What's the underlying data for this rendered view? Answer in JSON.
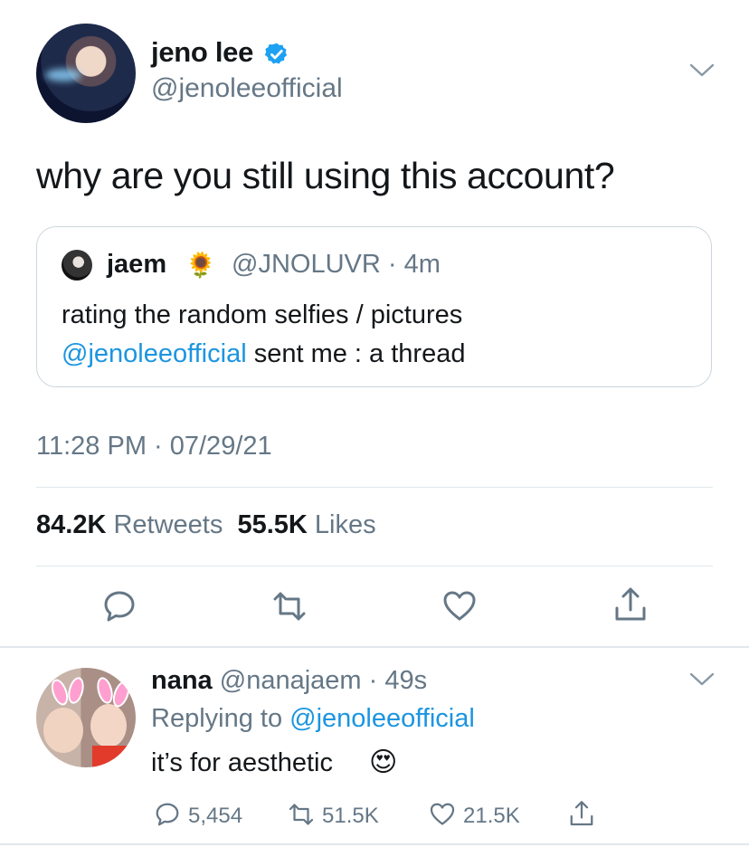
{
  "main_tweet": {
    "author_name": "jeno lee",
    "author_handle": "@jenoleeofficial",
    "text": "why are you still using this account?",
    "timestamp": "11:28 PM · 07/29/21",
    "retweets_count": "84.2K",
    "retweets_label": "Retweets",
    "likes_count": "55.5K",
    "likes_label": "Likes"
  },
  "quote": {
    "author_name": "jaem",
    "emoji": "🌻",
    "handle_time": "@JNOLUVR · 4m",
    "text_line1": "rating the random selfies / pictures",
    "mention": "@jenoleeofficial",
    "text_line2_rest": " sent me : a thread"
  },
  "reply": {
    "author_name": "nana",
    "handle_time": "@nanajaem · 49s",
    "replying_prefix": "Replying to ",
    "replying_to": "@jenoleeofficial",
    "text": "it’s for aesthetic",
    "emoji": "😍",
    "reply_count": "5,454",
    "retweet_count": "51.5K",
    "like_count": "21.5K"
  },
  "icons": {
    "verified": "verified-badge-icon",
    "menu": "chevron-down-icon",
    "reply": "reply-icon",
    "retweet": "retweet-icon",
    "like": "heart-icon",
    "share": "share-icon"
  },
  "colors": {
    "link": "#1b95e0",
    "muted": "#657786",
    "verified": "#1da1f2"
  }
}
